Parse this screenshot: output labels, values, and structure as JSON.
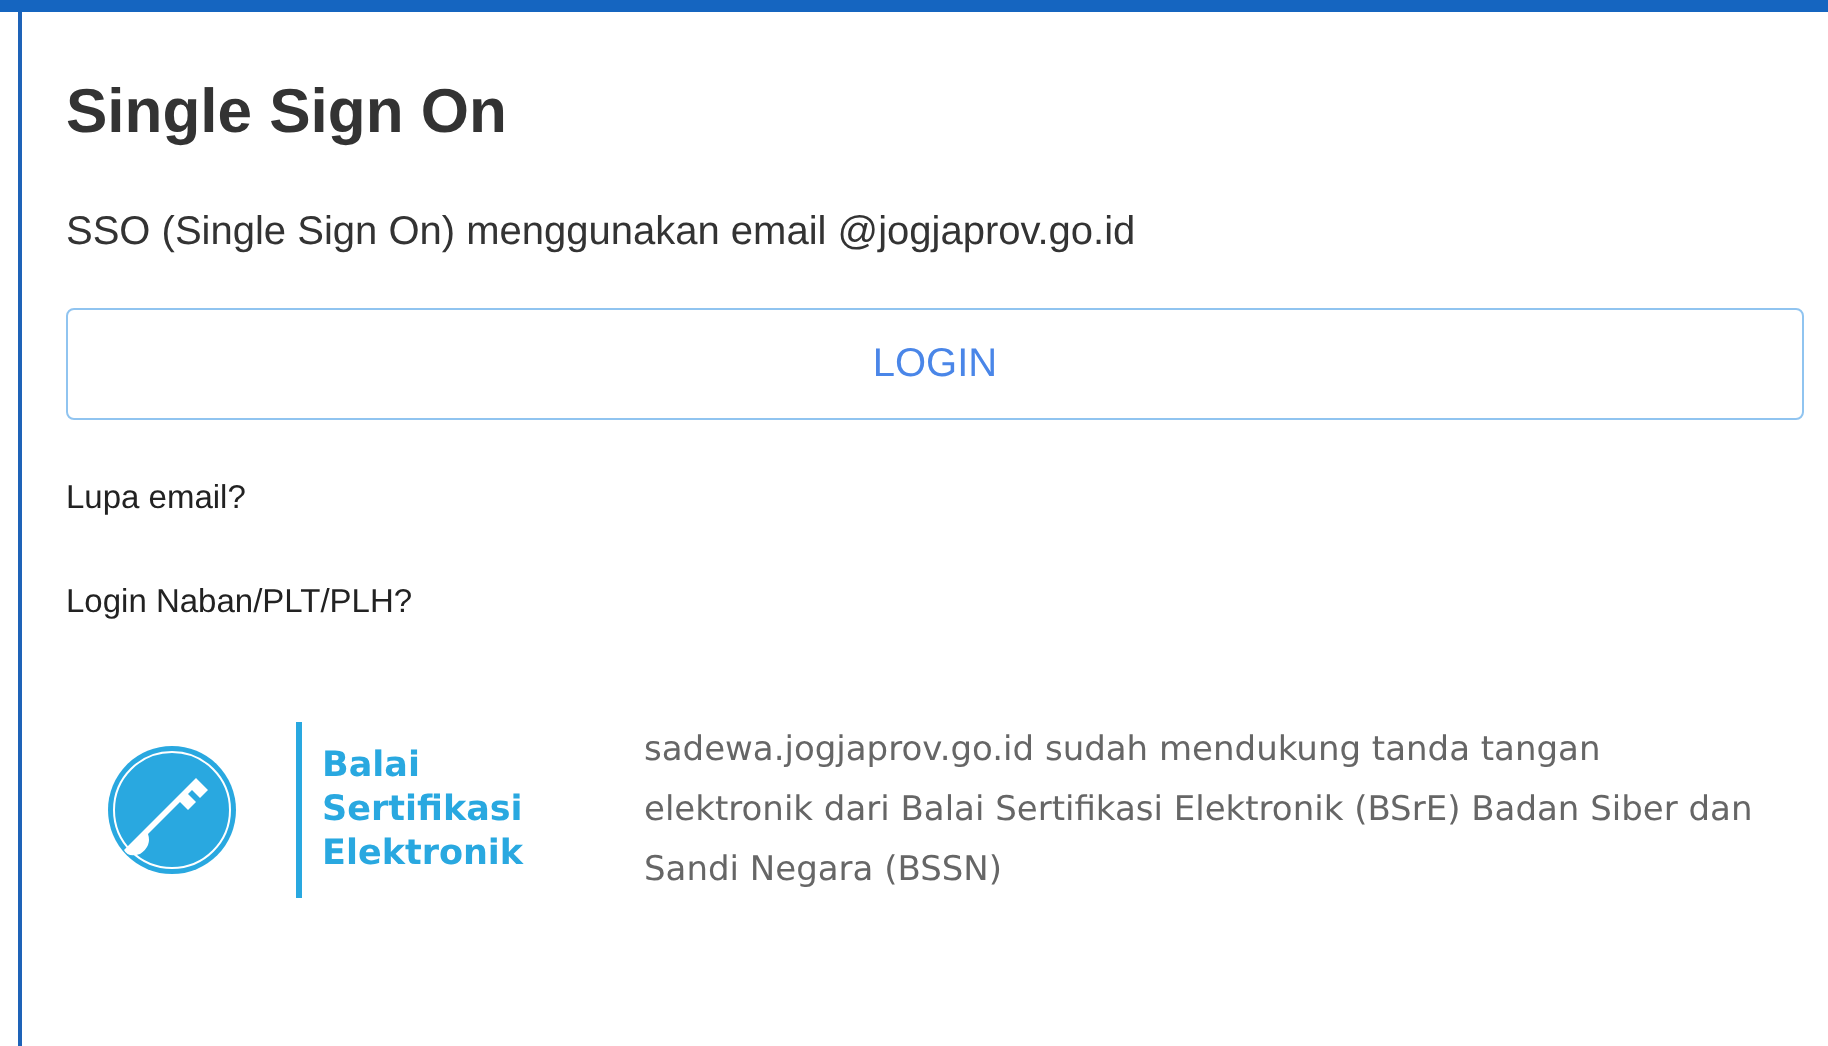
{
  "title": "Single Sign On",
  "description": "SSO (Single Sign On) menggunakan email @jogjaprov.go.id",
  "login_button": "LOGIN",
  "links": [
    "Lupa email?",
    "Login Naban/PLT/PLH?"
  ],
  "logo": {
    "lines": [
      "Balai",
      "Sertifikasi",
      "Elektronik"
    ]
  },
  "notice": "sadewa.jogjaprov.go.id sudah mendukung tanda tangan elektronik dari Balai Sertifikasi Elektronik (BSrE) Badan Siber dan Sandi Negara (BSSN)"
}
